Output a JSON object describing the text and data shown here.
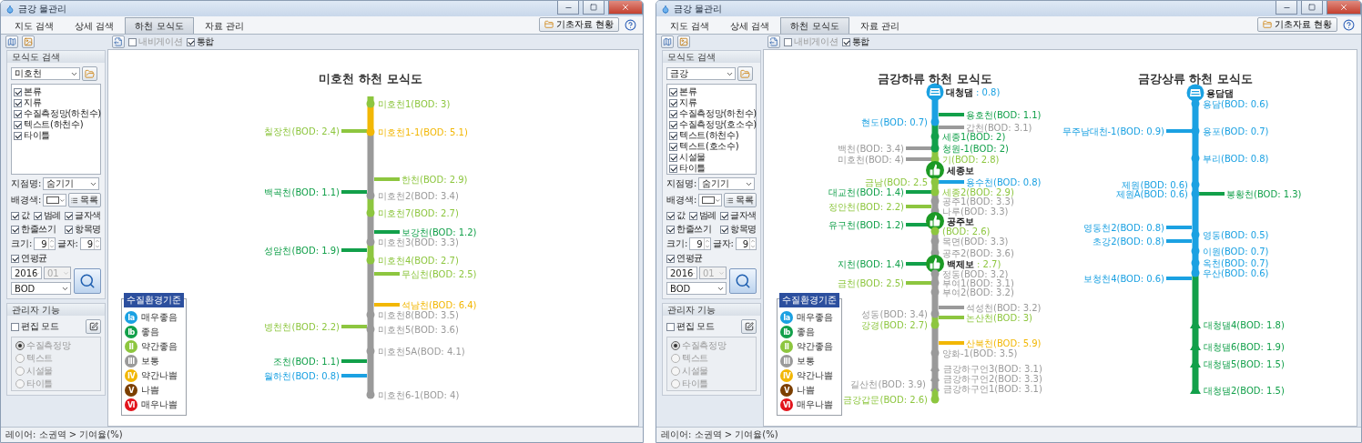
{
  "windows": [
    {
      "title": "금강 물관리",
      "tabs": [
        {
          "label": "지도 검색",
          "selected": false
        },
        {
          "label": "상세 검색",
          "selected": false
        },
        {
          "label": "하천 모식도",
          "selected": true
        },
        {
          "label": "자료 관리",
          "selected": false
        }
      ],
      "info_button": "기초자료 현황",
      "toolbar": {
        "options": [
          {
            "label": "내비게이션",
            "checked": false
          },
          {
            "label": "통합",
            "checked": true
          }
        ]
      },
      "sidebar": {
        "search_title": "모식도 검색",
        "river": "미호천",
        "layers": [
          {
            "label": "본류",
            "checked": true
          },
          {
            "label": "지류",
            "checked": true
          },
          {
            "label": "수질측정망(하천수)",
            "checked": true
          },
          {
            "label": "텍스트(하천수)",
            "checked": true
          },
          {
            "label": "타이틀",
            "checked": true
          }
        ],
        "station_name": {
          "label": "지점명:",
          "value": "숨기기"
        },
        "background": {
          "label": "배경색:"
        },
        "list_button": "목록",
        "display_options": [
          {
            "label": "값",
            "checked": true
          },
          {
            "label": "범례",
            "checked": true
          },
          {
            "label": "글자색",
            "checked": true
          },
          {
            "label": "한줄쓰기",
            "checked": true
          },
          {
            "label": "항목명",
            "checked": true
          }
        ],
        "size": {
          "label": "크기:",
          "value": "9"
        },
        "font": {
          "label": "글자:",
          "value": "9"
        },
        "annual_average": {
          "label": "연평균",
          "checked": true
        },
        "year": "2016",
        "month": {
          "value": "01",
          "disabled": true
        },
        "parameter": "BOD",
        "admin_title": "관리자 기능",
        "edit_mode": {
          "label": "편집 모드",
          "checked": false
        },
        "edit_targets": [
          {
            "label": "수질측정망",
            "selected": true,
            "disabled": true
          },
          {
            "label": "텍스트",
            "selected": false,
            "disabled": true
          },
          {
            "label": "시설물",
            "selected": false,
            "disabled": true
          },
          {
            "label": "타이틀",
            "selected": false,
            "disabled": true
          }
        ]
      },
      "legend": {
        "title": "수질환경기준",
        "grades": [
          {
            "badge": "Ia",
            "label": "매우좋음",
            "color": "#1ba1e2"
          },
          {
            "badge": "Ib",
            "label": "좋음",
            "color": "#12a04a"
          },
          {
            "badge": "II",
            "label": "약간좋음",
            "color": "#8dc63f"
          },
          {
            "badge": "III",
            "label": "보통",
            "color": "#9a9a9a"
          },
          {
            "badge": "IV",
            "label": "약간나쁨",
            "color": "#f2b705"
          },
          {
            "badge": "V",
            "label": "나쁨",
            "color": "#7b3f00"
          },
          {
            "badge": "VI",
            "label": "매우나쁨",
            "color": "#e2141c"
          }
        ]
      },
      "diagrams": [
        {
          "title": "미호천 하천 모식도",
          "items": [
            {
              "kind": "station",
              "left": false,
              "label": "미호천1(BOD: 3)",
              "color": "#8dc63f"
            },
            {
              "kind": "branch",
              "left": true,
              "label": "칠장천(BOD: 2.4)",
              "color": "#8dc63f"
            },
            {
              "kind": "station",
              "left": false,
              "label": "미호천1-1(BOD: 5.1)",
              "color": "#f2b705"
            },
            {
              "kind": "branch",
              "left": false,
              "label": "한천(BOD: 2.9)",
              "color": "#8dc63f"
            },
            {
              "kind": "branch",
              "left": true,
              "label": "백곡천(BOD: 1.1)",
              "color": "#12a04a"
            },
            {
              "kind": "station",
              "left": false,
              "label": "미호천2(BOD: 3.4)",
              "color": "#9a9a9a"
            },
            {
              "kind": "station",
              "left": false,
              "label": "미호천7(BOD: 2.7)",
              "color": "#8dc63f"
            },
            {
              "kind": "branch",
              "left": false,
              "label": "보강천(BOD: 1.2)",
              "color": "#12a04a"
            },
            {
              "kind": "station",
              "left": false,
              "label": "미호천3(BOD: 3.3)",
              "color": "#9a9a9a"
            },
            {
              "kind": "branch",
              "left": true,
              "label": "성암천(BOD: 1.9)",
              "color": "#12a04a"
            },
            {
              "kind": "station",
              "left": false,
              "label": "미호천4(BOD: 2.7)",
              "color": "#8dc63f"
            },
            {
              "kind": "branch",
              "left": false,
              "label": "무심천(BOD: 2.5)",
              "color": "#8dc63f"
            },
            {
              "kind": "branch",
              "left": false,
              "label": "석남천(BOD: 6.4)",
              "color": "#f2b705"
            },
            {
              "kind": "station",
              "left": false,
              "label": "미호천8(BOD: 3.5)",
              "color": "#9a9a9a"
            },
            {
              "kind": "branch",
              "left": true,
              "label": "병천천(BOD: 2.2)",
              "color": "#8dc63f"
            },
            {
              "kind": "station",
              "left": false,
              "label": "미호천5(BOD: 3.6)",
              "color": "#9a9a9a"
            },
            {
              "kind": "station",
              "left": false,
              "label": "미호천5A(BOD: 4.1)",
              "color": "#9a9a9a"
            },
            {
              "kind": "branch",
              "left": true,
              "label": "조천(BOD: 1.1)",
              "color": "#12a04a"
            },
            {
              "kind": "branch",
              "left": true,
              "label": "월하천(BOD: 0.8)",
              "color": "#1ba1e2"
            },
            {
              "kind": "station",
              "left": false,
              "label": "미호천6-1(BOD: 4)",
              "color": "#9a9a9a"
            }
          ]
        }
      ],
      "status_bar": "레이어: 소권역 > 기여율(%)"
    },
    {
      "title": "금강 물관리",
      "tabs": [
        {
          "label": "지도 검색",
          "selected": false
        },
        {
          "label": "상세 검색",
          "selected": false
        },
        {
          "label": "하천 모식도",
          "selected": true
        },
        {
          "label": "자료 관리",
          "selected": false
        }
      ],
      "info_button": "기초자료 현황",
      "toolbar": {
        "options": [
          {
            "label": "내비게이션",
            "checked": false
          },
          {
            "label": "통합",
            "checked": true
          }
        ]
      },
      "sidebar": {
        "search_title": "모식도 검색",
        "river": "금강",
        "layers": [
          {
            "label": "본류",
            "checked": true
          },
          {
            "label": "지류",
            "checked": true
          },
          {
            "label": "수질측정망(하천수)",
            "checked": true
          },
          {
            "label": "수질측정망(호소수)",
            "checked": true
          },
          {
            "label": "텍스트(하천수)",
            "checked": true
          },
          {
            "label": "텍스트(호소수)",
            "checked": true
          },
          {
            "label": "시설물",
            "checked": true
          },
          {
            "label": "타이틀",
            "checked": true
          }
        ],
        "station_name": {
          "label": "지점명:",
          "value": "숨기기"
        },
        "background": {
          "label": "배경색:"
        },
        "list_button": "목록",
        "display_options": [
          {
            "label": "값",
            "checked": true
          },
          {
            "label": "범례",
            "checked": true
          },
          {
            "label": "글자색",
            "checked": true
          },
          {
            "label": "한줄쓰기",
            "checked": true
          },
          {
            "label": "항목명",
            "checked": true
          }
        ],
        "size": {
          "label": "크기:",
          "value": "9"
        },
        "font": {
          "label": "글자:",
          "value": "9"
        },
        "annual_average": {
          "label": "연평균",
          "checked": true
        },
        "year": "2016",
        "month": {
          "value": "01",
          "disabled": true
        },
        "parameter": "BOD",
        "admin_title": "관리자 기능",
        "edit_mode": {
          "label": "편집 모드",
          "checked": false
        },
        "edit_targets": [
          {
            "label": "수질측정망",
            "selected": true,
            "disabled": true
          },
          {
            "label": "텍스트",
            "selected": false,
            "disabled": true
          },
          {
            "label": "시설물",
            "selected": false,
            "disabled": true
          },
          {
            "label": "타이틀",
            "selected": false,
            "disabled": true
          }
        ]
      },
      "legend": {
        "title": "수질환경기준",
        "grades": [
          {
            "badge": "Ia",
            "label": "매우좋음",
            "color": "#1ba1e2"
          },
          {
            "badge": "Ib",
            "label": "좋음",
            "color": "#12a04a"
          },
          {
            "badge": "II",
            "label": "약간좋음",
            "color": "#8dc63f"
          },
          {
            "badge": "III",
            "label": "보통",
            "color": "#9a9a9a"
          },
          {
            "badge": "IV",
            "label": "약간나쁨",
            "color": "#f2b705"
          },
          {
            "badge": "V",
            "label": "나쁨",
            "color": "#7b3f00"
          },
          {
            "badge": "VI",
            "label": "매우나쁨",
            "color": "#e2141c"
          }
        ]
      },
      "diagrams": [
        {
          "title": "금강하류 하천 모식도",
          "items": [
            {
              "kind": "dam",
              "label": "대청댐",
              "reading": ": 0.8)",
              "color": "#1ba1e2"
            },
            {
              "kind": "branch",
              "left": false,
              "label": "용호천(BOD: 1.1)",
              "color": "#12a04a"
            },
            {
              "kind": "station",
              "left": true,
              "label": "현도(BOD: 0.7)",
              "color": "#1ba1e2"
            },
            {
              "kind": "branch",
              "left": false,
              "label": "갑천(BOD: 3.1)",
              "color": "#9a9a9a"
            },
            {
              "kind": "station",
              "left": false,
              "label": "세종1(BOD: 2)",
              "color": "#12a04a"
            },
            {
              "kind": "branch",
              "left": true,
              "label": "백천(BOD: 3.4)",
              "color": "#9a9a9a"
            },
            {
              "kind": "station",
              "left": false,
              "label": "청원-1(BOD: 2)",
              "color": "#12a04a"
            },
            {
              "kind": "branch",
              "left": true,
              "label": "미호천(BOD: 4)",
              "color": "#9a9a9a"
            },
            {
              "kind": "station",
              "left": false,
              "label": "기(BOD: 2.8)",
              "color": "#8dc63f"
            },
            {
              "kind": "weir",
              "label": "세종보"
            },
            {
              "kind": "station",
              "left": true,
              "label": "금남(BOD: 2.5",
              "color": "#8dc63f"
            },
            {
              "kind": "branch",
              "left": false,
              "label": "용수천(BOD: 0.8)",
              "color": "#1ba1e2"
            },
            {
              "kind": "branch",
              "left": true,
              "label": "대교천(BOD: 1.4)",
              "color": "#12a04a"
            },
            {
              "kind": "station",
              "left": false,
              "label": "세종2(BOD: 2.9)",
              "color": "#8dc63f"
            },
            {
              "kind": "station",
              "left": false,
              "label": "공주1(BOD: 3.3)",
              "color": "#9a9a9a"
            },
            {
              "kind": "branch",
              "left": true,
              "label": "정안천(BOD: 2.2)",
              "color": "#8dc63f"
            },
            {
              "kind": "station",
              "left": false,
              "label": "나루(BOD: 3.3)",
              "color": "#9a9a9a"
            },
            {
              "kind": "weir",
              "label": "공주보"
            },
            {
              "kind": "branch",
              "left": true,
              "label": "유구천(BOD: 1.2)",
              "color": "#12a04a"
            },
            {
              "kind": "station",
              "left": false,
              "label": "(BOD: 2.6)",
              "color": "#8dc63f"
            },
            {
              "kind": "station",
              "left": false,
              "label": "목면(BOD: 3.3)",
              "color": "#9a9a9a"
            },
            {
              "kind": "station",
              "left": false,
              "label": "공주2(BOD: 3.6)",
              "color": "#9a9a9a"
            },
            {
              "kind": "branch",
              "left": true,
              "label": "지천(BOD: 1.4)",
              "color": "#12a04a"
            },
            {
              "kind": "weir",
              "label": "백제보",
              "reading": ": 2.7)",
              "color": "#8dc63f"
            },
            {
              "kind": "station",
              "left": false,
              "label": "정동(BOD: 3.2)",
              "color": "#9a9a9a"
            },
            {
              "kind": "branch",
              "left": true,
              "label": "금천(BOD: 2.5)",
              "color": "#8dc63f"
            },
            {
              "kind": "station",
              "left": false,
              "label": "부여1(BOD: 3.1)",
              "color": "#9a9a9a"
            },
            {
              "kind": "station",
              "left": false,
              "label": "부여2(BOD: 3.2)",
              "color": "#9a9a9a"
            },
            {
              "kind": "branch",
              "left": false,
              "label": "석성천(BOD: 3.2)",
              "color": "#9a9a9a"
            },
            {
              "kind": "station",
              "left": true,
              "label": "성동(BOD: 3.4)",
              "color": "#9a9a9a"
            },
            {
              "kind": "branch",
              "left": false,
              "label": "논산천(BOD: 3)",
              "color": "#8dc63f"
            },
            {
              "kind": "station",
              "left": true,
              "label": "강경(BOD: 2.7)",
              "color": "#8dc63f"
            },
            {
              "kind": "branch",
              "left": false,
              "label": "산북천(BOD: 5.9)",
              "color": "#f2b705"
            },
            {
              "kind": "station",
              "left": false,
              "label": "양화-1(BOD: 3.5)",
              "color": "#9a9a9a"
            },
            {
              "kind": "estuary",
              "left": false,
              "label": "금강하구언3(BOD: 3.1)",
              "color": "#9a9a9a"
            },
            {
              "kind": "estuary",
              "left": false,
              "label": "금강하구언2(BOD: 3.3)",
              "color": "#9a9a9a"
            },
            {
              "kind": "tributary",
              "left": true,
              "label": "길산천(BOD: 3.9)",
              "color": "#9a9a9a"
            },
            {
              "kind": "estuary",
              "left": false,
              "label": "금강하구언1(BOD: 3.1)",
              "color": "#9a9a9a"
            },
            {
              "kind": "station",
              "left": true,
              "label": "금강갑문(BOD: 2.6)",
              "color": "#8dc63f"
            }
          ]
        },
        {
          "title": "금강상류 하천 모식도",
          "items": [
            {
              "kind": "dam",
              "label": "용담댐"
            },
            {
              "kind": "station",
              "left": false,
              "label": "용담(BOD: 0.6)",
              "color": "#1ba1e2"
            },
            {
              "kind": "branch",
              "left": true,
              "label": "무주남대천-1(BOD: 0.9)",
              "color": "#1ba1e2"
            },
            {
              "kind": "station",
              "left": false,
              "label": "용포(BOD: 0.7)",
              "color": "#1ba1e2"
            },
            {
              "kind": "station",
              "left": false,
              "label": "부리(BOD: 0.8)",
              "color": "#1ba1e2"
            },
            {
              "kind": "station",
              "left": true,
              "label": "제원(BOD: 0.6)",
              "color": "#1ba1e2"
            },
            {
              "kind": "station",
              "left": true,
              "label": "제원A(BOD: 0.6)",
              "color": "#1ba1e2"
            },
            {
              "kind": "branch",
              "left": false,
              "label": "봉황천(BOD: 1.3)",
              "color": "#12a04a"
            },
            {
              "kind": "branch",
              "left": true,
              "label": "영동천2(BOD: 0.8)",
              "color": "#1ba1e2"
            },
            {
              "kind": "station",
              "left": false,
              "label": "영동(BOD: 0.5)",
              "color": "#1ba1e2"
            },
            {
              "kind": "branch",
              "left": true,
              "label": "초강2(BOD: 0.8)",
              "color": "#1ba1e2"
            },
            {
              "kind": "station",
              "left": false,
              "label": "이원(BOD: 0.7)",
              "color": "#1ba1e2"
            },
            {
              "kind": "station",
              "left": false,
              "label": "옥천(BOD: 0.7)",
              "color": "#1ba1e2"
            },
            {
              "kind": "station",
              "left": false,
              "label": "우산(BOD: 0.6)",
              "color": "#1ba1e2"
            },
            {
              "kind": "branch",
              "left": true,
              "label": "보청천4(BOD: 0.6)",
              "color": "#1ba1e2"
            },
            {
              "kind": "lake",
              "left": false,
              "label": "대청댐4(BOD: 1.8)",
              "color": "#12a04a"
            },
            {
              "kind": "lake",
              "left": false,
              "label": "대청댐6(BOD: 1.9)",
              "color": "#12a04a"
            },
            {
              "kind": "lake",
              "left": false,
              "label": "대청댐5(BOD: 1.5)",
              "color": "#12a04a"
            },
            {
              "kind": "lake",
              "left": false,
              "label": "대청댐2(BOD: 1.5)",
              "color": "#12a04a"
            }
          ]
        }
      ],
      "status_bar": "레이어: 소권역 > 기여율(%)"
    }
  ]
}
